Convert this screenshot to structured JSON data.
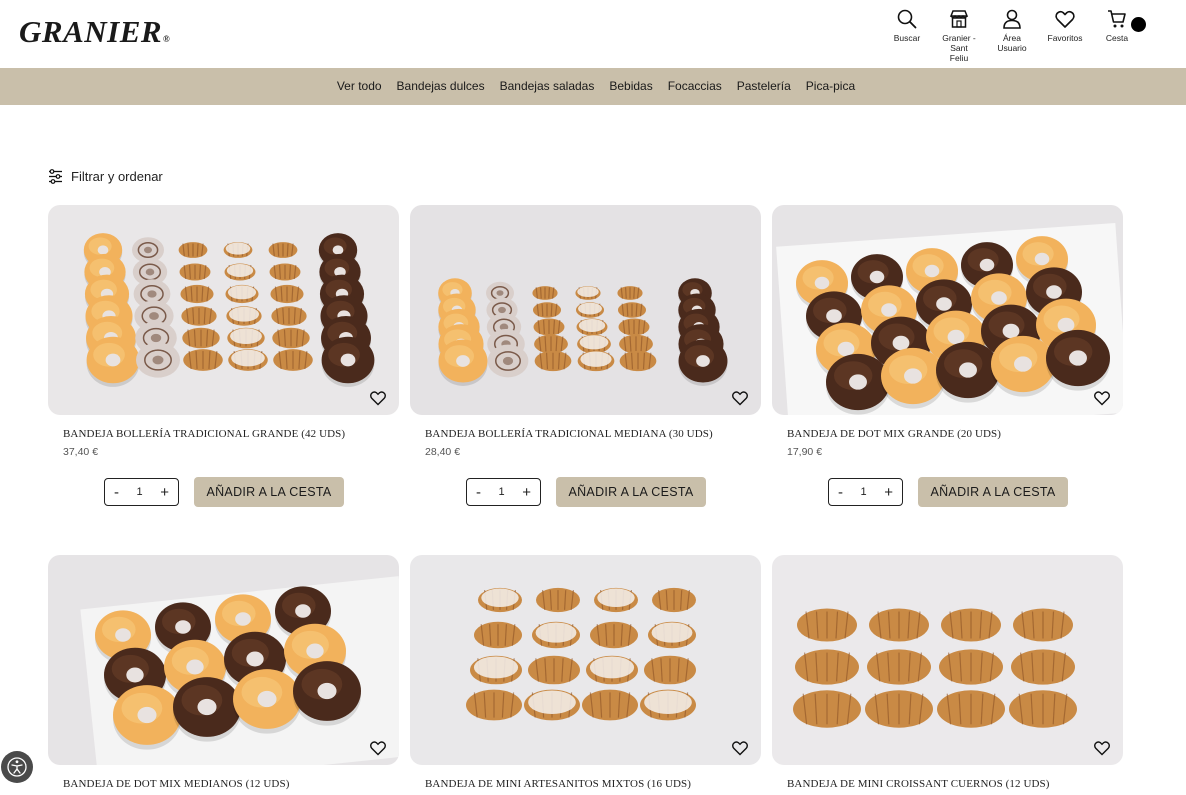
{
  "header": {
    "logo": "GRANIER",
    "logo_mark": "®",
    "icons": [
      {
        "name": "search-icon",
        "label": "Buscar"
      },
      {
        "name": "store-icon",
        "label": "Granier - Sant Feliu"
      },
      {
        "name": "user-icon",
        "label": "Área Usuario"
      },
      {
        "name": "heart-icon",
        "label": "Favoritos"
      },
      {
        "name": "cart-icon",
        "label": "Cesta"
      }
    ]
  },
  "categories": [
    "Ver todo",
    "Bandejas dulces",
    "Bandejas saladas",
    "Bebidas",
    "Focaccias",
    "Pastelería",
    "Pica-pica"
  ],
  "filter": {
    "label": "Filtrar y ordenar"
  },
  "products": [
    {
      "name": "BANDEJA BOLLERÍA TRADICIONAL GRANDE (42 UDS)",
      "price": "37,40 €",
      "qty": "1",
      "add_label": "AÑADIR A LA CESTA"
    },
    {
      "name": "BANDEJA BOLLERÍA TRADICIONAL MEDIANA (30 UDS)",
      "price": "28,40 €",
      "qty": "1",
      "add_label": "AÑADIR A LA CESTA"
    },
    {
      "name": "BANDEJA DE DOT MIX GRANDE (20 UDS)",
      "price": "17,90 €",
      "qty": "1",
      "add_label": "AÑADIR A LA CESTA"
    },
    {
      "name": "BANDEJA DE DOT MIX MEDIANOS (12 UDS)"
    },
    {
      "name": "BANDEJA DE MINI ARTESANITOS MIXTOS (16 UDS)"
    },
    {
      "name": "BANDEJA DE MINI CROISSANT CUERNOS (12 UDS)"
    }
  ],
  "stepper": {
    "minus": "-",
    "plus": "+"
  },
  "colors": {
    "accent": "#c9bfaa",
    "text": "#222222",
    "chocolate": "#4a2a1c",
    "glaze": "#f2b25c"
  }
}
